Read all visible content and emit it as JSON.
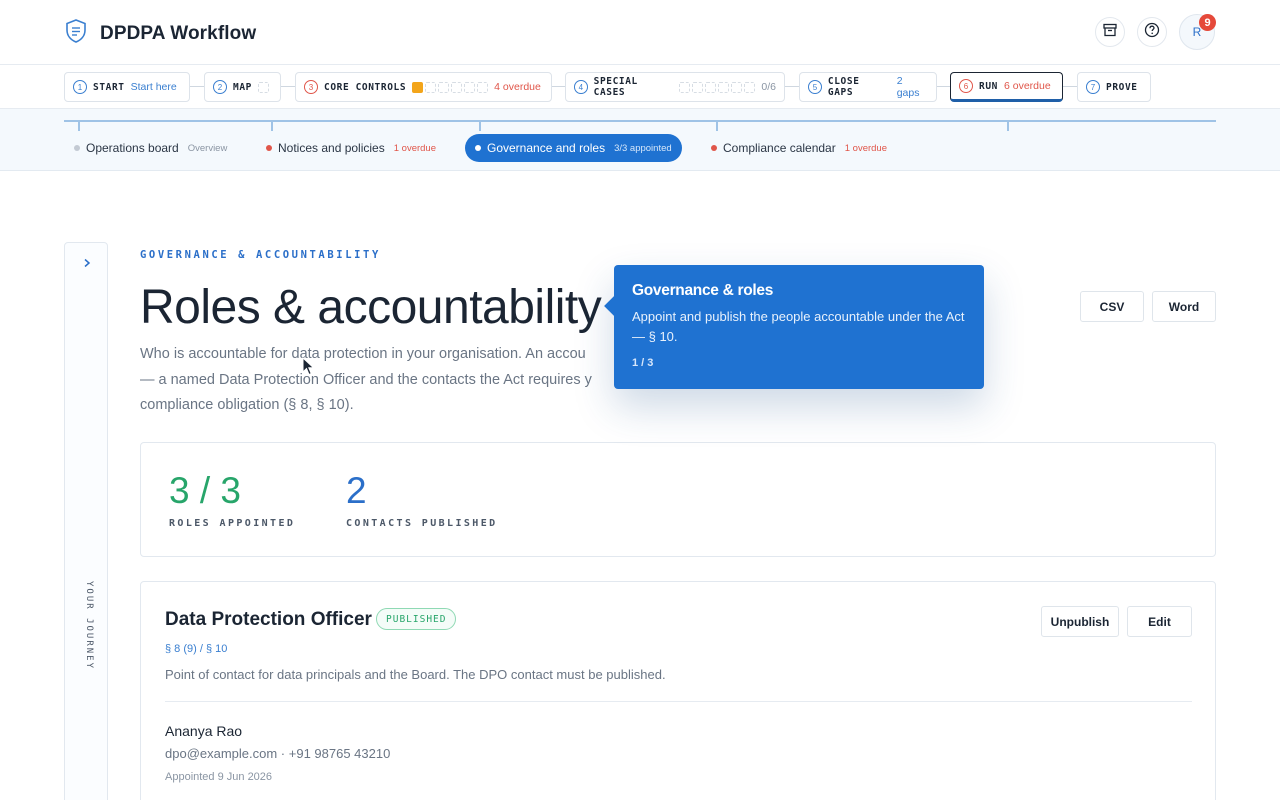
{
  "app": {
    "title": "DPDPA Workflow",
    "notification_count": "9",
    "avatar_initial": "R"
  },
  "stepper": [
    {
      "num": "1",
      "label": "START",
      "meta": "Start here",
      "state": "info"
    },
    {
      "num": "2",
      "label": "MAP",
      "meta": "",
      "state": "neutral"
    },
    {
      "num": "3",
      "label": "CORE CONTROLS",
      "meta": "4 overdue",
      "state": "alert",
      "progress_boxes": {
        "total": 6,
        "filled": 1
      }
    },
    {
      "num": "4",
      "label": "SPECIAL CASES",
      "meta": "0/6",
      "state": "neutral",
      "progress_boxes": {
        "total": 6,
        "filled": 0
      }
    },
    {
      "num": "5",
      "label": "CLOSE GAPS",
      "meta": "2 gaps",
      "state": "info"
    },
    {
      "num": "6",
      "label": "RUN",
      "meta": "6 overdue",
      "state": "alert",
      "active": true
    },
    {
      "num": "7",
      "label": "PROVE",
      "meta": "",
      "state": "info"
    }
  ],
  "subnav": [
    {
      "label": "Operations board",
      "meta": "Overview"
    },
    {
      "label": "Notices and policies",
      "meta": "1 overdue"
    },
    {
      "label": "Governance and roles",
      "meta": "3/3 appointed",
      "active": true
    },
    {
      "label": "Compliance calendar",
      "meta": "1 overdue"
    }
  ],
  "journey": {
    "label": "YOUR JOURNEY"
  },
  "page": {
    "eyebrow": "GOVERNANCE & ACCOUNTABILITY",
    "title": "Roles & accountability",
    "intro_line1": "Who is accountable for data protection in your organisation. An accou",
    "intro_line2": "— a named Data Protection Officer and the contacts the Act requires y",
    "intro_line3": "compliance obligation (§ 8, § 10).",
    "csv_label": "CSV",
    "word_label": "Word"
  },
  "stats": [
    {
      "value": "3 / 3",
      "label": "ROLES APPOINTED",
      "color": "#27a56a"
    },
    {
      "value": "2",
      "label": "CONTACTS PUBLISHED",
      "color": "#2b6fc9"
    }
  ],
  "role": {
    "title": "Data Protection Officer",
    "status": "PUBLISHED",
    "reference": "§ 8 (9) / § 10",
    "description": "Point of contact for data principals and the Board. The DPO contact must be published.",
    "unpublish_label": "Unpublish",
    "edit_label": "Edit",
    "person_name": "Ananya Rao",
    "person_contact": "dpo@example.com · +91 98765 43210",
    "appointed": "Appointed 9 Jun 2026"
  },
  "tooltip": {
    "title": "Governance & roles",
    "body": "Appoint and publish the people accountable under the Act — § 10.",
    "count": "1 / 3"
  },
  "colors": {
    "accent": "#1f72d1",
    "alert": "#e0564a",
    "success": "#27a56a",
    "progress": "#f3a51a"
  }
}
